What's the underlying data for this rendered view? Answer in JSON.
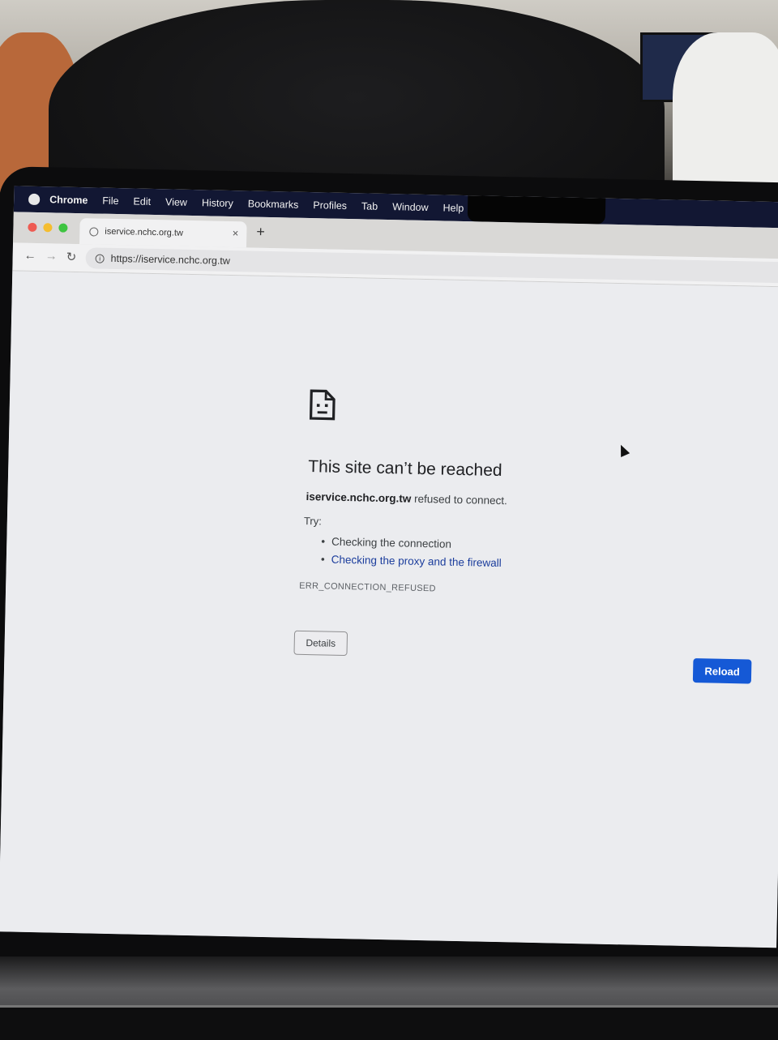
{
  "menubar": {
    "items": [
      "Chrome",
      "File",
      "Edit",
      "View",
      "History",
      "Bookmarks",
      "Profiles",
      "Tab",
      "Window",
      "Help"
    ]
  },
  "tab": {
    "title": "iservice.nchc.org.tw",
    "close_glyph": "×",
    "new_tab_glyph": "+"
  },
  "toolbar": {
    "back_glyph": "←",
    "forward_glyph": "→",
    "reload_glyph": "↻",
    "url": "https://iservice.nchc.org.tw"
  },
  "error": {
    "title": "This site can’t be reached",
    "host": "iservice.nchc.org.tw",
    "refused_text": " refused to connect.",
    "try_label": "Try:",
    "suggestions": [
      "Checking the connection",
      "Checking the proxy and the firewall"
    ],
    "code": "ERR_CONNECTION_REFUSED",
    "details_label": "Details",
    "reload_label": "Reload"
  },
  "colors": {
    "menubar_bg": "#121733",
    "link": "#1a3c9c",
    "reload_button": "#1559d6",
    "close_dot": "#ee5b52",
    "minimize_dot": "#f5bd2f",
    "zoom_dot": "#3ec440"
  },
  "icons": [
    "apple-logo-icon",
    "globe-icon",
    "close-icon",
    "plus-icon",
    "back-arrow-icon",
    "forward-arrow-icon",
    "reload-icon",
    "info-icon",
    "sad-page-icon",
    "cursor-icon"
  ]
}
